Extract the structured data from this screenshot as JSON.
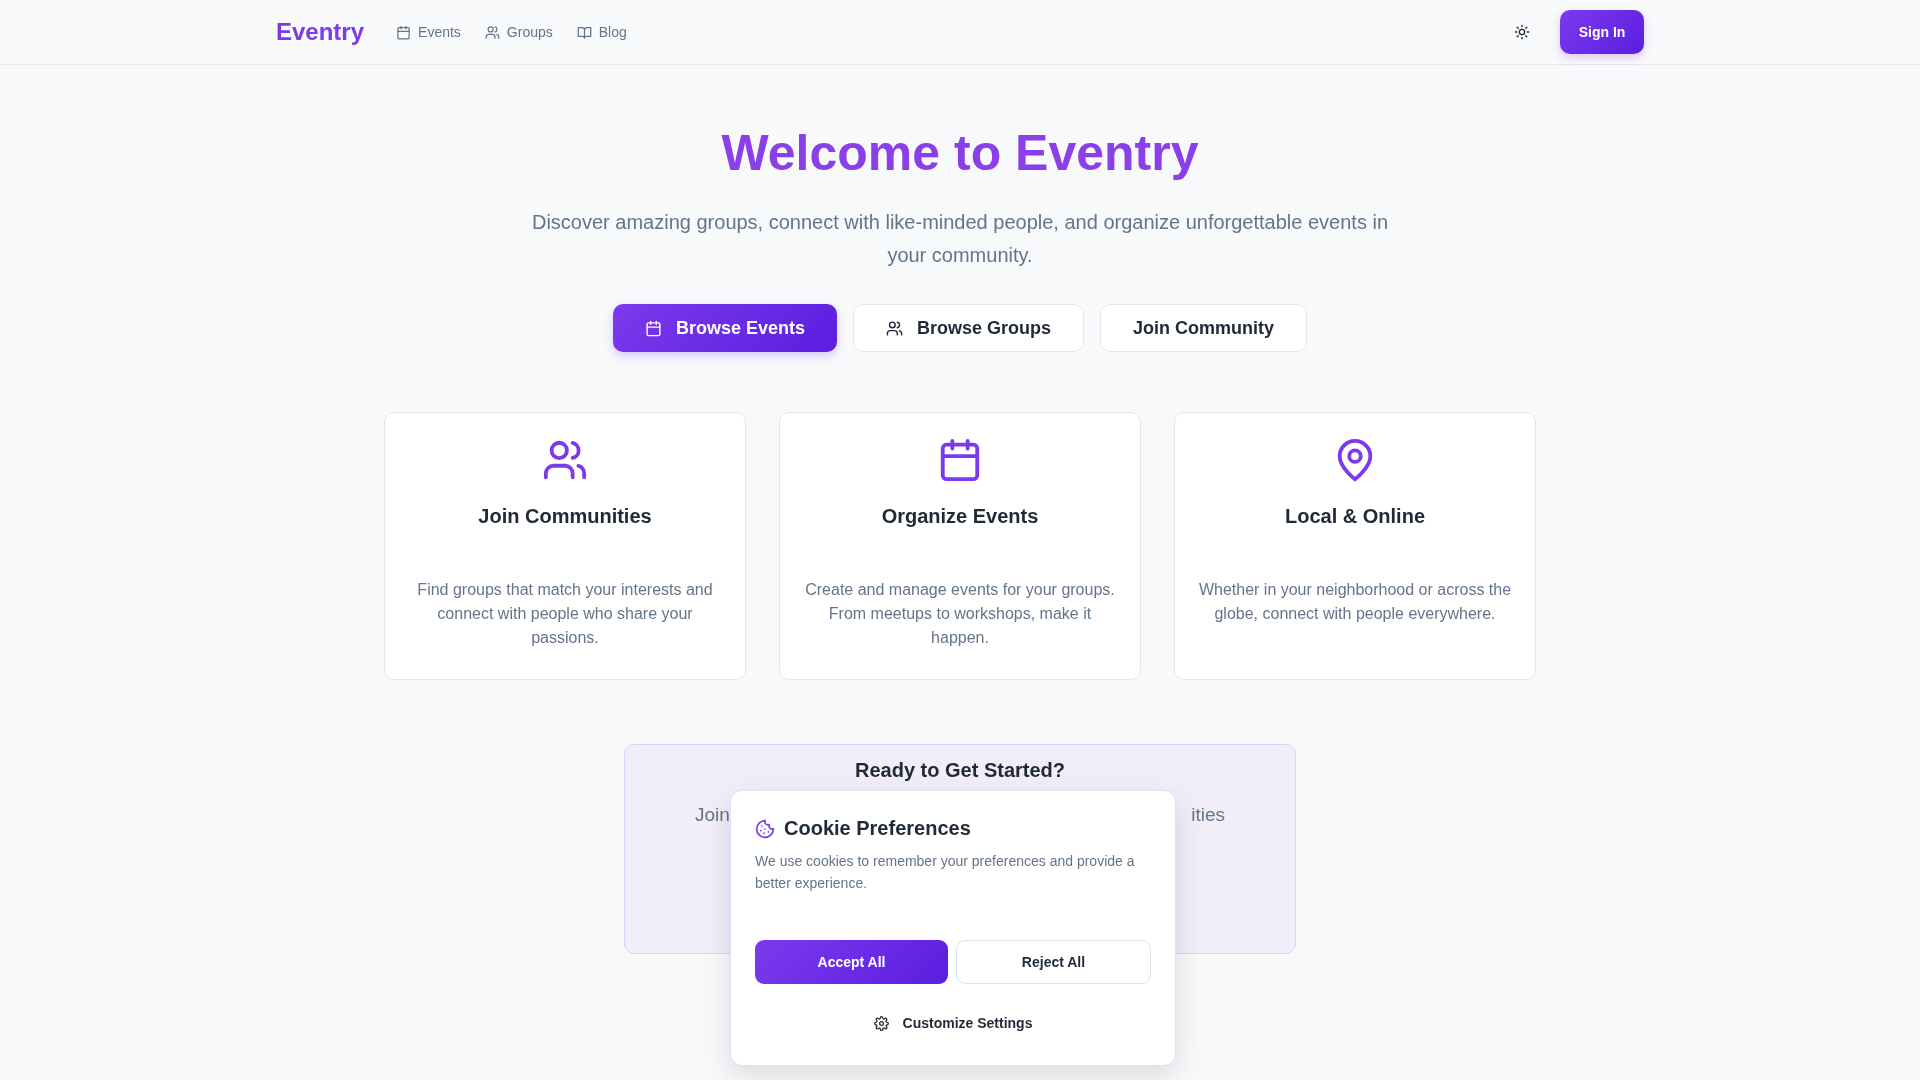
{
  "header": {
    "logo": "Eventry",
    "nav": [
      {
        "label": "Events"
      },
      {
        "label": "Groups"
      },
      {
        "label": "Blog"
      }
    ],
    "sign_in": "Sign In"
  },
  "hero": {
    "title": "Welcome to Eventry",
    "subtitle": "Discover amazing groups, connect with like-minded people, and organize unforgettable events in your community.",
    "buttons": [
      {
        "label": "Browse Events",
        "kind": "primary"
      },
      {
        "label": "Browse Groups",
        "kind": "outline"
      },
      {
        "label": "Join Community",
        "kind": "outline"
      }
    ]
  },
  "features": [
    {
      "title": "Join Communities",
      "text": "Find groups that match your interests and connect with people who share your passions."
    },
    {
      "title": "Organize Events",
      "text": "Create and manage events for your groups. From meetups to workshops, make it happen."
    },
    {
      "title": "Local & Online",
      "text": "Whether in your neighborhood or across the globe, connect with people everywhere."
    }
  ],
  "cta": {
    "title": "Ready to Get Started?",
    "text_left": "Join",
    "text_right": "ities"
  },
  "cookie_dialog": {
    "title": "Cookie Preferences",
    "text": "We use cookies to remember your preferences and provide a better experience.",
    "accept": "Accept All",
    "reject": "Reject All",
    "customize": "Customize Settings"
  }
}
